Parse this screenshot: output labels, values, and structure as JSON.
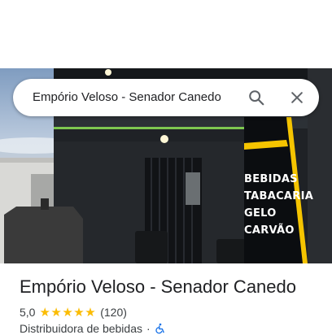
{
  "search": {
    "query": "Empório Veloso - Senador Canedo"
  },
  "storefront_sign": [
    "BEBIDAS",
    "TABACARIA",
    "GELO",
    "CARVÃO"
  ],
  "place": {
    "name": "Empório Veloso - Senador Canedo",
    "rating": "5,0",
    "stars": "★★★★★",
    "review_count": "(120)",
    "category": "Distribuidora de bebidas",
    "separator": "·"
  },
  "colors": {
    "star": "#fbbc04",
    "sign_text": "#ffffff",
    "sign_accent": "#f5c400",
    "accessibility_icon": "#1a73e8"
  },
  "icons": [
    "search-icon",
    "close-icon",
    "wheelchair-accessible-icon"
  ]
}
